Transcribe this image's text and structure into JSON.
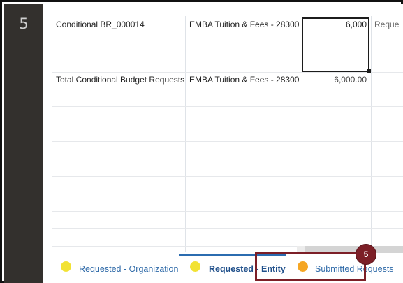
{
  "step": {
    "number": "5"
  },
  "grid": {
    "rows": [
      {
        "name": "Conditional BR_000014",
        "entity": "EMBA Tuition & Fees - 28300",
        "value": "6,000",
        "clipped": "Reque"
      },
      {
        "name": "Total Conditional Budget Requests",
        "entity": "EMBA Tuition & Fees - 28300",
        "value": "6,000.00"
      }
    ]
  },
  "tabs": [
    {
      "label": "Requested - Organization",
      "dot_color": "#f2e233",
      "active": false
    },
    {
      "label": "Requested - Entity",
      "dot_color": "#f2e233",
      "active": true
    },
    {
      "label": "Submitted Requests",
      "dot_color": "#f5a623",
      "active": false
    }
  ],
  "callout": {
    "badge": "5"
  },
  "colors": {
    "accent": "#2b6cb0",
    "callout": "#7c1f27",
    "sidebar": "#33302d"
  }
}
